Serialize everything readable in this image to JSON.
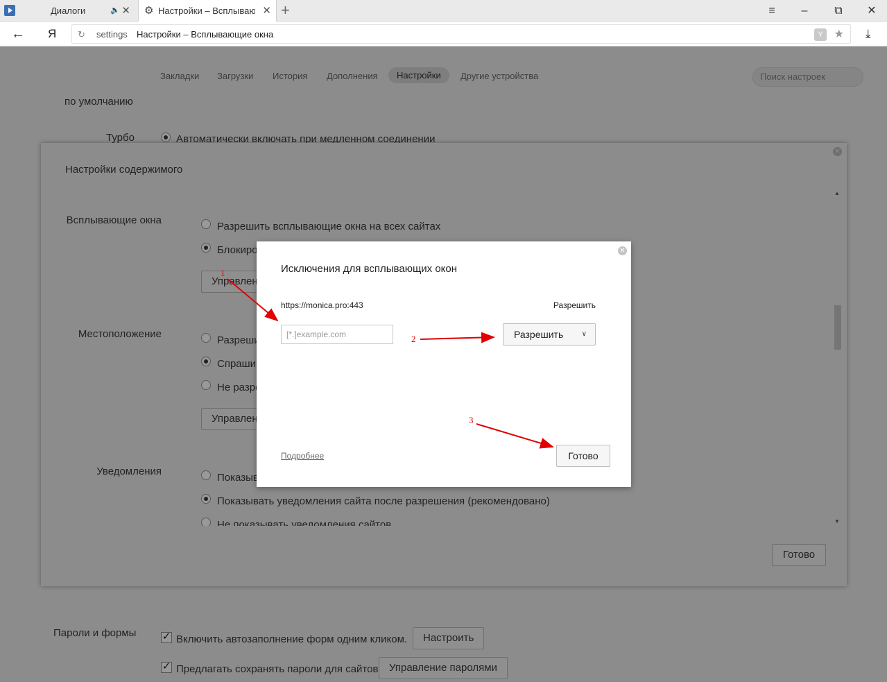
{
  "browser": {
    "tabs": [
      {
        "title": "Диалоги",
        "active": false
      },
      {
        "title": "Настройки – Всплывающ",
        "active": true
      }
    ],
    "address": {
      "host": "settings",
      "title": "Настройки – Всплывающие окна"
    },
    "yandex_button": "Я"
  },
  "settings_nav": {
    "links": [
      "Закладки",
      "Загрузки",
      "История",
      "Дополнения",
      "Настройки",
      "Другие устройства"
    ],
    "active": "Настройки",
    "search_placeholder": "Поиск настроек"
  },
  "background": {
    "default_fragment": "по умолчанию",
    "turbo_label": "Турбо",
    "turbo_option": "Автоматически включать при медленном соединении",
    "passwords_label": "Пароли и формы",
    "autofill_option": "Включить автозаполнение форм одним кликом.",
    "autofill_button": "Настроить",
    "save_passwords_option": "Предлагать сохранять пароли для сайтов",
    "manage_passwords_button": "Управление паролями"
  },
  "content_dialog": {
    "title": "Настройки содержимого",
    "done_label": "Готово",
    "popups": {
      "label": "Всплывающие окна",
      "options": [
        "Разрешить всплывающие окна на всех сайтах",
        "Блокиро"
      ],
      "selected": 1,
      "manage_button": "Управлен"
    },
    "location": {
      "label": "Местоположение",
      "options": [
        "Разреши",
        "Спраши",
        "Не разре"
      ],
      "selected": 1,
      "manage_button": "Управлен"
    },
    "notifications": {
      "label": "Уведомления",
      "options": [
        "Показыв",
        "Показывать уведомления сайта после разрешения (рекомендовано)",
        "Не показывать уведомления сайтов"
      ],
      "selected": 1
    }
  },
  "exceptions_modal": {
    "title": "Исключения для всплывающих окон",
    "existing_host": "https://monica.pro:443",
    "existing_action": "Разрешить",
    "input_placeholder": "[*.]example.com",
    "select_value": "Разрешить",
    "more_link": "Подробнее",
    "done_label": "Готово"
  },
  "annotations": {
    "color": "#e00000",
    "labels": [
      "1",
      "2",
      "3"
    ]
  }
}
